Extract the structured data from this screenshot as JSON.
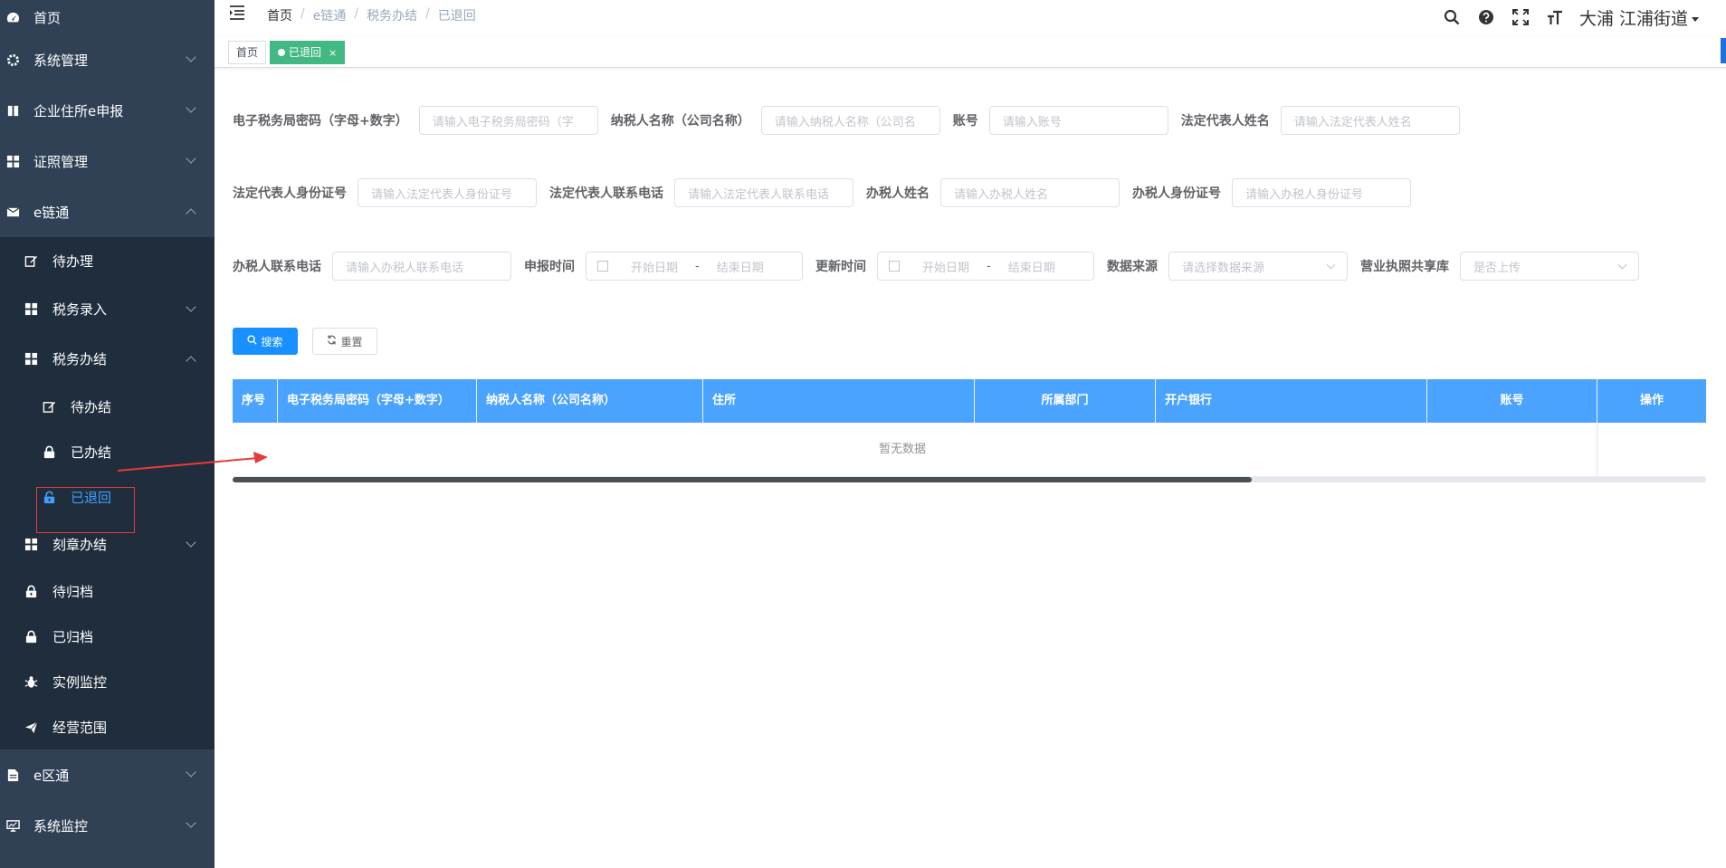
{
  "sidebar": {
    "items": [
      {
        "label": "首页",
        "icon": "dashboard-icon"
      },
      {
        "label": "系统管理",
        "icon": "gear-icon"
      },
      {
        "label": "企业住所e申报",
        "icon": "book-icon"
      },
      {
        "label": "证照管理",
        "icon": "grid-icon"
      },
      {
        "label": "e链通",
        "icon": "mail-icon"
      }
    ],
    "sub_items": {
      "pending": "待办理",
      "tax_entry": "税务录入",
      "tax_done": "税务办结",
      "tax_done_pending": "待办结",
      "tax_done_finished": "已办结",
      "tax_done_returned": "已退回",
      "seal": "刻章办结",
      "to_archive": "待归档",
      "archived": "已归档",
      "instance_monitor": "实例监控",
      "business_scope": "经营范围"
    },
    "bottom": {
      "e_district": "e区通",
      "system_monitor": "系统监控"
    }
  },
  "navbar": {
    "breadcrumb": [
      "首页",
      "e链通",
      "税务办结",
      "已退回"
    ],
    "breadcrumb_sep": "/",
    "user": "大浦  江浦街道"
  },
  "tags": {
    "home": "首页",
    "current": "已退回",
    "close": "×"
  },
  "form": {
    "row1": [
      {
        "label": "电子税务局密码（字母+数字）",
        "placeholder": "请输入电子税务局密码（字"
      },
      {
        "label": "纳税人名称（公司名称）",
        "placeholder": "请输入纳税人名称（公司名"
      },
      {
        "label": "账号",
        "placeholder": "请输入账号"
      },
      {
        "label": "法定代表人姓名",
        "placeholder": "请输入法定代表人姓名"
      }
    ],
    "row2": [
      {
        "label": "法定代表人身份证号",
        "placeholder": "请输入法定代表人身份证号"
      },
      {
        "label": "法定代表人联系电话",
        "placeholder": "请输入法定代表人联系电话"
      },
      {
        "label": "办税人姓名",
        "placeholder": "请输入办税人姓名"
      },
      {
        "label": "办税人身份证号",
        "placeholder": "请输入办税人身份证号"
      }
    ],
    "row3": {
      "tax_phone": {
        "label": "办税人联系电话",
        "placeholder": "请输入办税人联系电话"
      },
      "report_time": {
        "label": "申报时间",
        "start": "开始日期",
        "end": "结束日期",
        "dash": "-"
      },
      "update_time": {
        "label": "更新时间",
        "start": "开始日期",
        "end": "结束日期",
        "dash": "-"
      },
      "data_source": {
        "label": "数据来源",
        "placeholder": "请选择数据来源"
      },
      "license_share": {
        "label": "营业执照共享库",
        "placeholder": "是否上传"
      }
    },
    "search_button": "搜索",
    "reset_button": "重置"
  },
  "table": {
    "columns": [
      "序号",
      "电子税务局密码（字母+数字）",
      "纳税人名称（公司名称）",
      "住所",
      "所属部门",
      "开户银行",
      "账号",
      "操作"
    ],
    "empty_text": "暂无数据",
    "horizontal_scroll_position": 0.69
  },
  "colors": {
    "sidebar_bg": "#304156",
    "accent": "#409eff",
    "table_header": "#4aa3ff",
    "active_tag": "#42b983",
    "annotation": "#e83a3a"
  }
}
